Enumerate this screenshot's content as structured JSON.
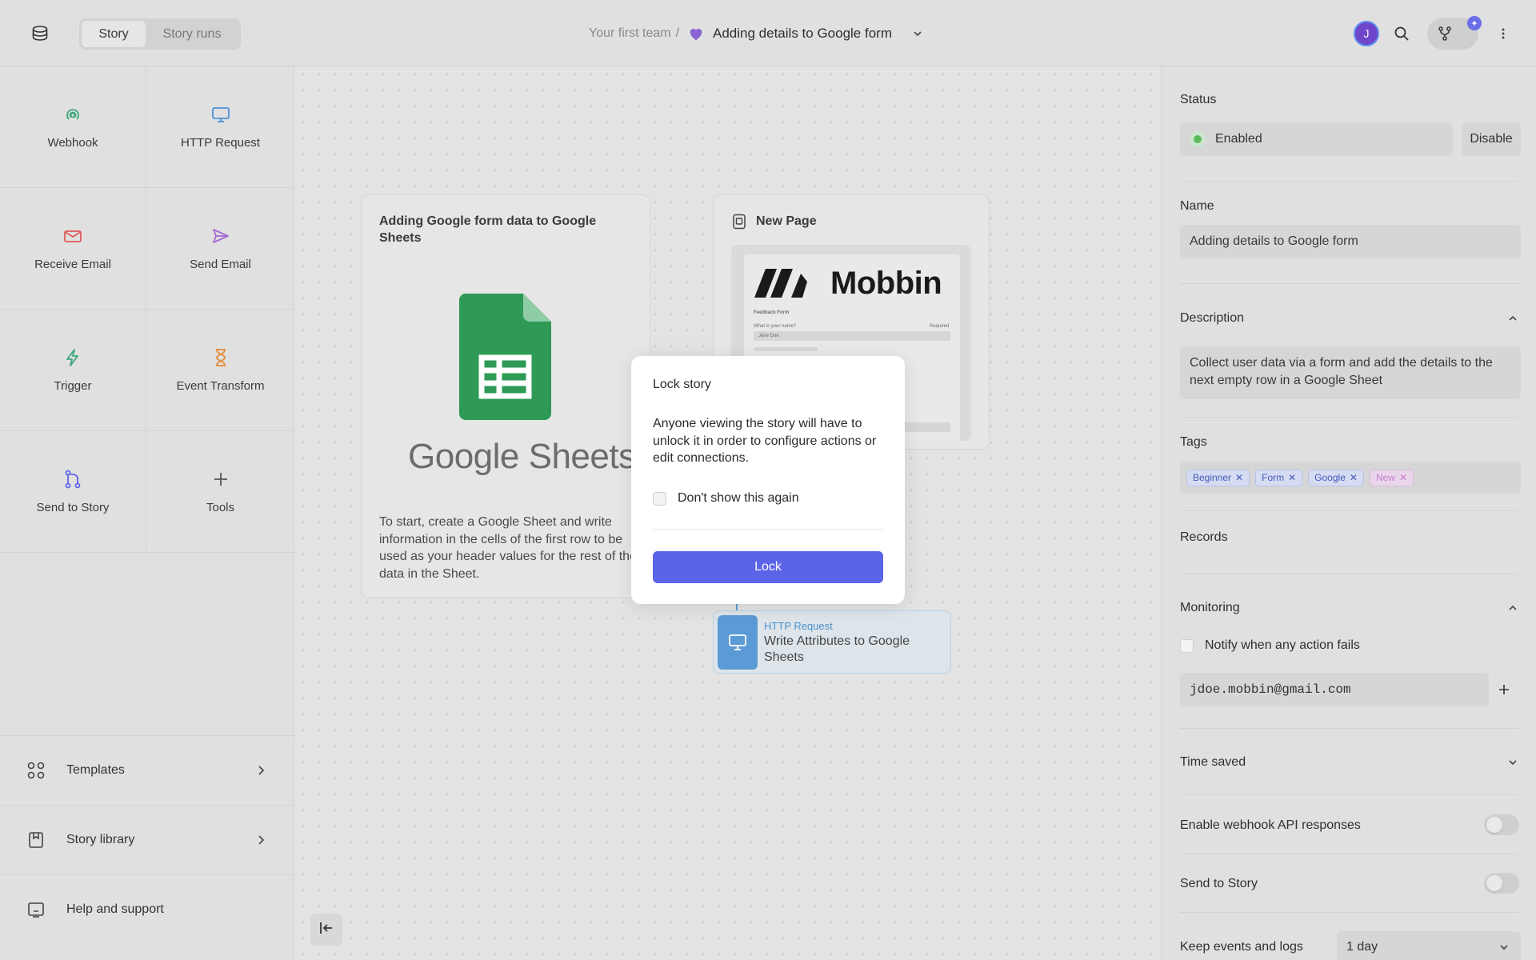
{
  "header": {
    "tabs": [
      {
        "label": "Story",
        "active": true
      },
      {
        "label": "Story runs",
        "active": false
      }
    ],
    "breadcrumb": {
      "team": "Your first team",
      "separator": "/",
      "story_title": "Adding details to Google form"
    },
    "avatar_initial": "J",
    "fork_badge": "✦"
  },
  "sidebar": {
    "tiles": [
      {
        "label": "Webhook",
        "icon": "webhook-icon",
        "color": "#3aa57a"
      },
      {
        "label": "HTTP Request",
        "icon": "monitor-icon",
        "color": "#4a90d9"
      },
      {
        "label": "Receive Email",
        "icon": "mail-icon",
        "color": "#e05a5a"
      },
      {
        "label": "Send Email",
        "icon": "send-icon",
        "color": "#a46bd6"
      },
      {
        "label": "Trigger",
        "icon": "bolt-icon",
        "color": "#3aa57a"
      },
      {
        "label": "Event Transform",
        "icon": "hourglass-icon",
        "color": "#e08a3a"
      },
      {
        "label": "Send to Story",
        "icon": "branch-icon",
        "color": "#5b63e8"
      },
      {
        "label": "Tools",
        "icon": "plus-icon",
        "color": "#555555"
      }
    ],
    "bottom": [
      {
        "label": "Templates",
        "icon": "grid-icon"
      },
      {
        "label": "Story library",
        "icon": "bookmark-icon"
      },
      {
        "label": "Help and support",
        "icon": "help-icon"
      }
    ]
  },
  "canvas": {
    "note": {
      "title": "Adding Google form data to Google Sheets",
      "logo_word": "Google Sheets",
      "text": "To start, create a Google Sheet and write information in the cells of the first row to be used as your header values for the rest of the data in the Sheet."
    },
    "page_card": {
      "title": "New Page",
      "thumb_brand": "Mobbin",
      "thumb_form_title": "Feedback Form",
      "thumb_question": "What is your name?",
      "thumb_required": "Required",
      "thumb_answer": "Jane Doe"
    },
    "action": {
      "type": "HTTP Request",
      "name": "Write Attributes to Google Sheets"
    }
  },
  "modal": {
    "title": "Lock story",
    "body": "Anyone viewing the story will have to unlock it in order to configure actions or edit connections.",
    "checkbox_label": "Don't show this again",
    "checkbox_checked": false,
    "button": "Lock"
  },
  "panel": {
    "status_label": "Status",
    "status_value": "Enabled",
    "disable_button": "Disable",
    "name_label": "Name",
    "name_value": "Adding details to Google form",
    "description_label": "Description",
    "description_value": "Collect user data via a form and add the details to the next empty row in a Google Sheet",
    "tags_label": "Tags",
    "tags": [
      {
        "label": "Beginner",
        "color": "blue"
      },
      {
        "label": "Form",
        "color": "blue"
      },
      {
        "label": "Google",
        "color": "blue"
      },
      {
        "label": "New",
        "color": "pink"
      }
    ],
    "records_label": "Records",
    "monitoring_label": "Monitoring",
    "notify_label": "Notify when any action fails",
    "notify_checked": false,
    "email_value": "jdoe.mobbin@gmail.com",
    "time_saved_label": "Time saved",
    "webhook_label": "Enable webhook API responses",
    "webhook_enabled": false,
    "send_to_story_label": "Send to Story",
    "send_to_story_enabled": false,
    "keep_label": "Keep events and logs",
    "keep_value": "1 day"
  },
  "colors": {
    "accent": "#5b63e8",
    "enabled_green": "#5cb85c",
    "sheets_green": "#2e9a55",
    "http_blue": "#5b9bd5"
  }
}
